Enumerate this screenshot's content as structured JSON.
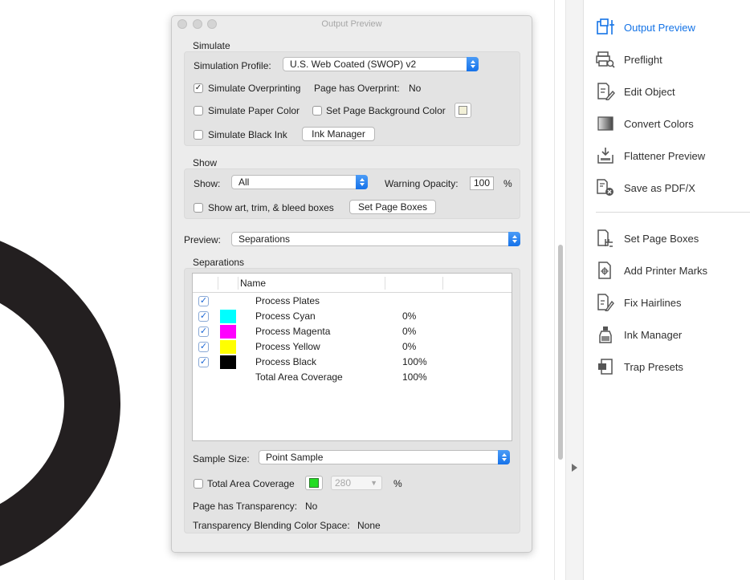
{
  "dialog": {
    "title": "Output Preview",
    "simulate": {
      "section_title": "Simulate",
      "profile_label": "Simulation Profile:",
      "profile_value": "U.S. Web Coated (SWOP) v2",
      "overprinting_label": "Simulate Overprinting",
      "overprinting_checked": true,
      "page_overprint_label": "Page has Overprint:",
      "page_overprint_value": "No",
      "paper_color_label": "Simulate Paper Color",
      "paper_color_checked": false,
      "page_bg_label": "Set Page Background Color",
      "page_bg_checked": false,
      "page_bg_swatch": "#f2f0d7",
      "black_ink_label": "Simulate Black Ink",
      "black_ink_checked": false,
      "ink_manager_button": "Ink Manager"
    },
    "show": {
      "section_title": "Show",
      "show_label": "Show:",
      "show_value": "All",
      "warning_opacity_label": "Warning Opacity:",
      "warning_opacity_value": "100",
      "warning_opacity_unit": "%",
      "boxes_label": "Show art, trim, & bleed boxes",
      "boxes_checked": false,
      "set_page_boxes_button": "Set Page Boxes"
    },
    "preview": {
      "label": "Preview:",
      "value": "Separations"
    },
    "separations": {
      "section_title": "Separations",
      "name_header": "Name",
      "rows": [
        {
          "checked": true,
          "color": "",
          "name": "Process Plates",
          "pct": ""
        },
        {
          "checked": true,
          "color": "#00ffff",
          "name": "Process Cyan",
          "pct": "0%"
        },
        {
          "checked": true,
          "color": "#ff00ff",
          "name": "Process Magenta",
          "pct": "0%"
        },
        {
          "checked": true,
          "color": "#ffff00",
          "name": "Process Yellow",
          "pct": "0%"
        },
        {
          "checked": true,
          "color": "#000000",
          "name": "Process Black",
          "pct": "100%"
        },
        {
          "checked": false,
          "color": "",
          "name": "Total Area Coverage",
          "pct": "100%"
        }
      ],
      "sample_size_label": "Sample Size:",
      "sample_size_value": "Point Sample",
      "tac_label": "Total Area Coverage",
      "tac_checked": false,
      "tac_swatch": "#22dd22",
      "tac_value": "280",
      "tac_unit": "%",
      "transparency_label": "Page has Transparency:",
      "transparency_value": "No",
      "blending_label": "Transparency Blending Color Space:",
      "blending_value": "None"
    }
  },
  "tools": {
    "accent": "#1473e6",
    "items": [
      {
        "label": "Output Preview",
        "icon": "output-preview-icon",
        "active": true
      },
      {
        "label": "Preflight",
        "icon": "preflight-icon",
        "active": false
      },
      {
        "label": "Edit Object",
        "icon": "edit-object-icon",
        "active": false
      },
      {
        "label": "Convert Colors",
        "icon": "convert-colors-icon",
        "active": false
      },
      {
        "label": "Flattener Preview",
        "icon": "flattener-preview-icon",
        "active": false
      },
      {
        "label": "Save as PDF/X",
        "icon": "save-as-pdfx-icon",
        "active": false
      },
      {
        "label": "Set Page Boxes",
        "icon": "set-page-boxes-icon",
        "active": false
      },
      {
        "label": "Add Printer Marks",
        "icon": "add-printer-marks-icon",
        "active": false
      },
      {
        "label": "Fix Hairlines",
        "icon": "fix-hairlines-icon",
        "active": false
      },
      {
        "label": "Ink Manager",
        "icon": "ink-manager-icon",
        "active": false
      },
      {
        "label": "Trap Presets",
        "icon": "trap-presets-icon",
        "active": false
      }
    ]
  }
}
